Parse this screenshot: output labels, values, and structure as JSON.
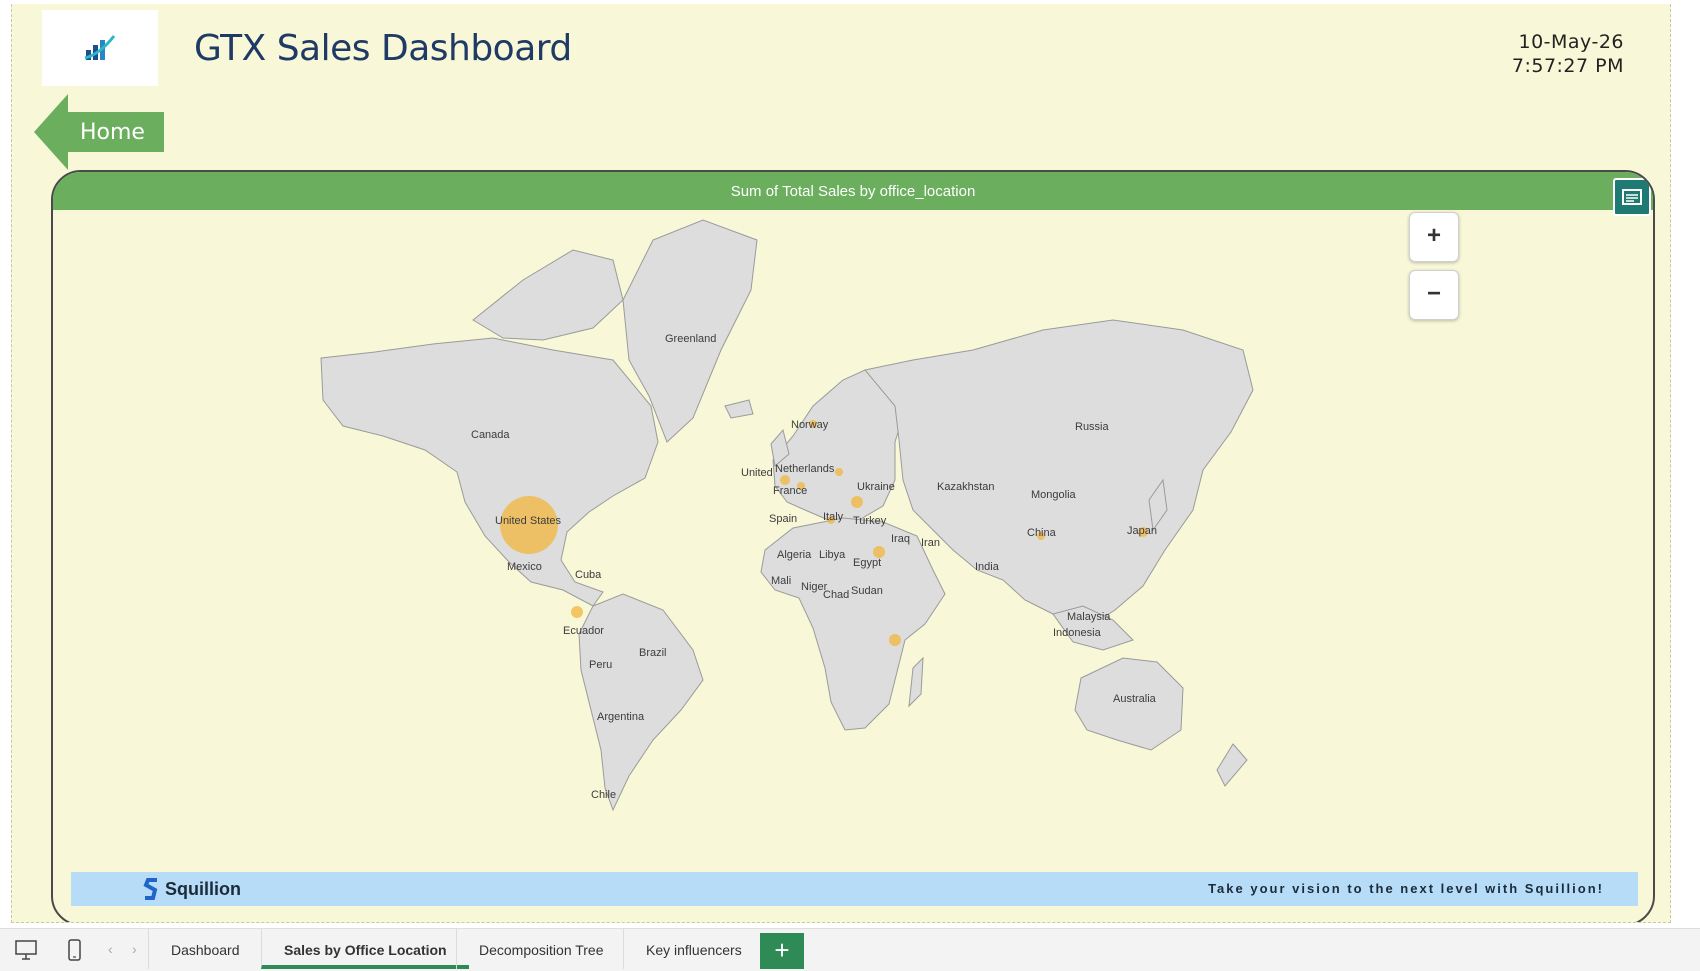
{
  "header": {
    "title": "GTX Sales Dashboard",
    "date": "10-May-26",
    "time": "7:57:27 PM",
    "logo_icon": "bar-chart-logo-icon"
  },
  "home_button": {
    "label": "Home",
    "icon": "left-arrow-shape"
  },
  "map_visual": {
    "title": "Sum of Total Sales by office_location",
    "focus_icon": "focus-mode-icon",
    "zoom_in_label": "+",
    "zoom_out_label": "−",
    "colors": {
      "land": "#dddddd",
      "border": "#9a9a9a",
      "bubble": "#f1b53c",
      "header": "#6aae5e"
    },
    "country_labels": [
      {
        "name": "Greenland"
      },
      {
        "name": "Canada"
      },
      {
        "name": "United States"
      },
      {
        "name": "Mexico"
      },
      {
        "name": "Cuba"
      },
      {
        "name": "Ecuador"
      },
      {
        "name": "Peru"
      },
      {
        "name": "Brazil"
      },
      {
        "name": "Argentina"
      },
      {
        "name": "Chile"
      },
      {
        "name": "Norway"
      },
      {
        "name": "United"
      },
      {
        "name": "Netherlands"
      },
      {
        "name": "France"
      },
      {
        "name": "Spain"
      },
      {
        "name": "Italy"
      },
      {
        "name": "Ukraine"
      },
      {
        "name": "Turkey"
      },
      {
        "name": "Iraq"
      },
      {
        "name": "Iran"
      },
      {
        "name": "Algeria"
      },
      {
        "name": "Libya"
      },
      {
        "name": "Egypt"
      },
      {
        "name": "Mali"
      },
      {
        "name": "Niger"
      },
      {
        "name": "Chad"
      },
      {
        "name": "Sudan"
      },
      {
        "name": "Russia"
      },
      {
        "name": "Kazakhstan"
      },
      {
        "name": "Mongolia"
      },
      {
        "name": "China"
      },
      {
        "name": "Japan"
      },
      {
        "name": "India"
      },
      {
        "name": "Malaysia"
      },
      {
        "name": "Indonesia"
      },
      {
        "name": "Australia"
      }
    ]
  },
  "banner": {
    "brand": "Squillion",
    "brand_icon": "squillion-s-logo-icon",
    "tagline": "Take your vision to the next level with Squillion!"
  },
  "tabbar": {
    "device_icons": [
      "desktop-icon",
      "phone-icon"
    ],
    "nav_icons": [
      "prev-page-icon",
      "next-page-icon"
    ],
    "tabs": [
      {
        "label": "Dashboard",
        "active": false
      },
      {
        "label": "Sales by Office Location",
        "active": true
      },
      {
        "label": "Decomposition Tree",
        "active": false
      },
      {
        "label": "Key influencers",
        "active": false
      }
    ],
    "add_label": "+"
  }
}
